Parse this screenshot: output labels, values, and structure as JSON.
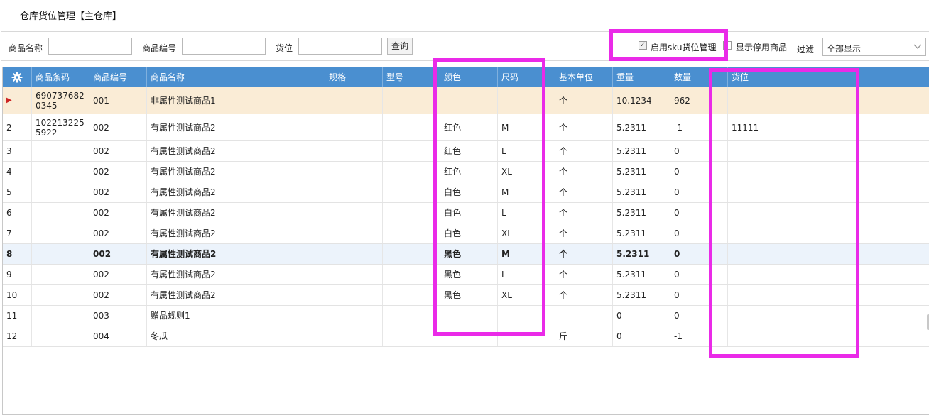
{
  "title": "仓库货位管理【主仓库】",
  "toolbar": {
    "name_label": "商品名称",
    "code_label": "商品编号",
    "location_label": "货位",
    "query_button": "查询",
    "sku_checkbox_label": "启用sku货位管理",
    "sku_checked": true,
    "show_disabled_label": "显示停用商品",
    "show_disabled_checked": false,
    "filter_label": "过滤",
    "filter_value": "全部显示"
  },
  "columns": [
    "商品条码",
    "商品编号",
    "商品名称",
    "规格",
    "型号",
    "颜色",
    "尺码",
    "基本单位",
    "重量",
    "数量",
    "货位"
  ],
  "rows": [
    {
      "idx": "",
      "barcode": "6907376820345",
      "code": "001",
      "name": "非属性测试商品1",
      "spec": "",
      "model": "",
      "color": "",
      "size": "",
      "unit": "个",
      "weight": "10.1234",
      "qty": "962",
      "location": ""
    },
    {
      "idx": "2",
      "barcode": "1022132255922",
      "code": "002",
      "name": "有属性测试商品2",
      "spec": "",
      "model": "",
      "color": "红色",
      "size": "M",
      "unit": "个",
      "weight": "5.2311",
      "qty": "-1",
      "location": "11111"
    },
    {
      "idx": "3",
      "barcode": "",
      "code": "002",
      "name": "有属性测试商品2",
      "spec": "",
      "model": "",
      "color": "红色",
      "size": "L",
      "unit": "个",
      "weight": "5.2311",
      "qty": "0",
      "location": ""
    },
    {
      "idx": "4",
      "barcode": "",
      "code": "002",
      "name": "有属性测试商品2",
      "spec": "",
      "model": "",
      "color": "红色",
      "size": "XL",
      "unit": "个",
      "weight": "5.2311",
      "qty": "0",
      "location": ""
    },
    {
      "idx": "5",
      "barcode": "",
      "code": "002",
      "name": "有属性测试商品2",
      "spec": "",
      "model": "",
      "color": "白色",
      "size": "M",
      "unit": "个",
      "weight": "5.2311",
      "qty": "0",
      "location": ""
    },
    {
      "idx": "6",
      "barcode": "",
      "code": "002",
      "name": "有属性测试商品2",
      "spec": "",
      "model": "",
      "color": "白色",
      "size": "L",
      "unit": "个",
      "weight": "5.2311",
      "qty": "0",
      "location": ""
    },
    {
      "idx": "7",
      "barcode": "",
      "code": "002",
      "name": "有属性测试商品2",
      "spec": "",
      "model": "",
      "color": "白色",
      "size": "XL",
      "unit": "个",
      "weight": "5.2311",
      "qty": "0",
      "location": ""
    },
    {
      "idx": "8",
      "barcode": "",
      "code": "002",
      "name": "有属性测试商品2",
      "spec": "",
      "model": "",
      "color": "黑色",
      "size": "M",
      "unit": "个",
      "weight": "5.2311",
      "qty": "0",
      "location": ""
    },
    {
      "idx": "9",
      "barcode": "",
      "code": "002",
      "name": "有属性测试商品2",
      "spec": "",
      "model": "",
      "color": "黑色",
      "size": "L",
      "unit": "个",
      "weight": "5.2311",
      "qty": "0",
      "location": ""
    },
    {
      "idx": "10",
      "barcode": "",
      "code": "002",
      "name": "有属性测试商品2",
      "spec": "",
      "model": "",
      "color": "黑色",
      "size": "XL",
      "unit": "个",
      "weight": "5.2311",
      "qty": "0",
      "location": ""
    },
    {
      "idx": "11",
      "barcode": "",
      "code": "003",
      "name": "赠品规则1",
      "spec": "",
      "model": "",
      "color": "",
      "size": "",
      "unit": "",
      "weight": "0",
      "qty": "0",
      "location": ""
    },
    {
      "idx": "12",
      "barcode": "",
      "code": "004",
      "name": "冬瓜",
      "spec": "",
      "model": "",
      "color": "",
      "size": "",
      "unit": "斤",
      "weight": "0",
      "qty": "-1",
      "location": ""
    }
  ],
  "selected_row": "8",
  "current_row_marker": "▶",
  "colors": {
    "header": "#4a8fd0",
    "current_row": "#faecd6",
    "highlight_box": "#ea2ae8"
  },
  "icons": {
    "settings": "gear-icon",
    "current_row": "row-pointer-icon"
  }
}
